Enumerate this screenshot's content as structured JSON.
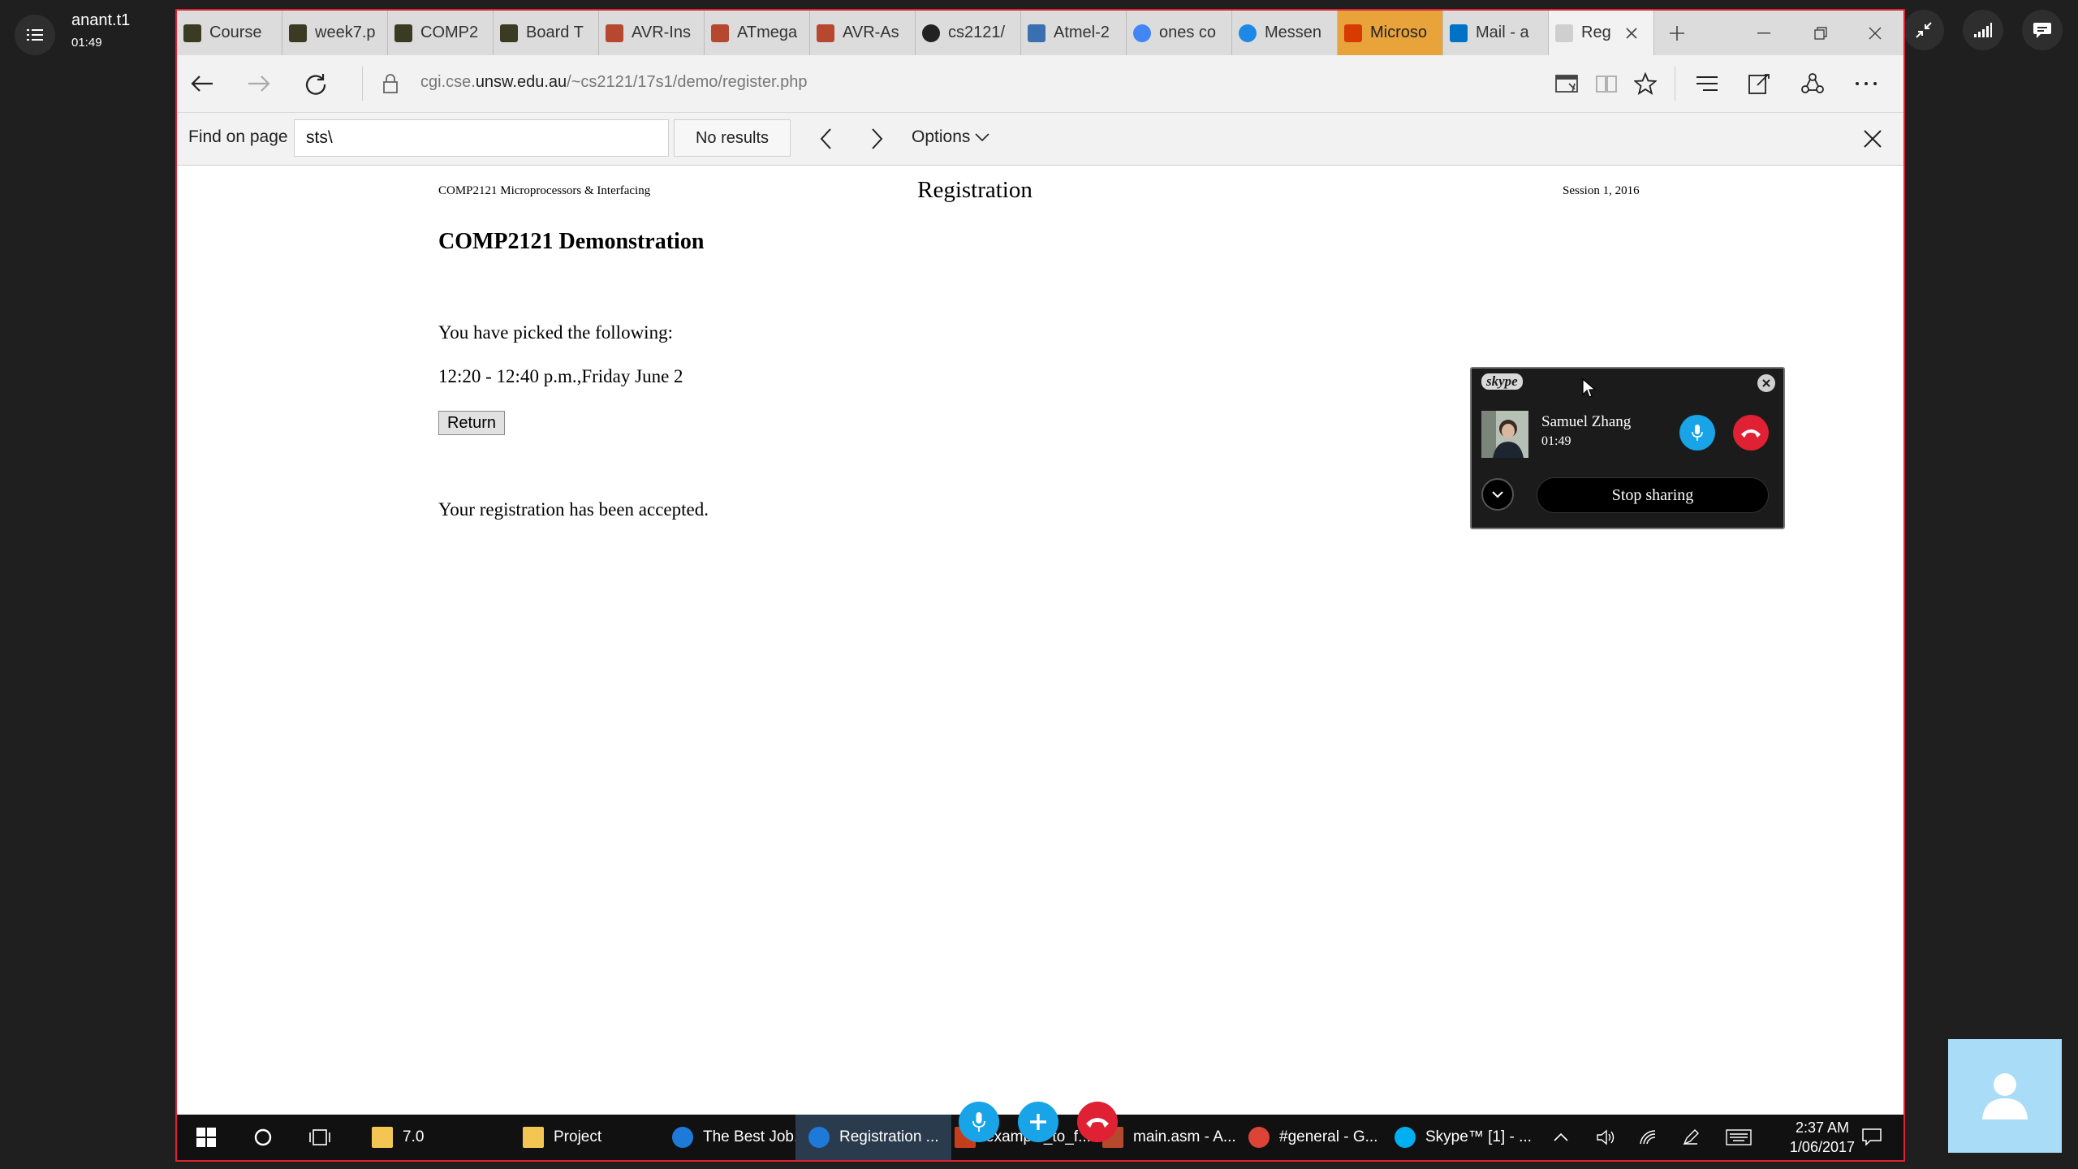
{
  "call": {
    "user_name": "anant.t1",
    "duration": "01:49",
    "menu_icon": "list-icon",
    "top_right_icons": [
      "minimize-icon",
      "signal-icon",
      "chat-icon"
    ]
  },
  "browser": {
    "tabs": [
      {
        "label": "Course"
      },
      {
        "label": "week7.p"
      },
      {
        "label": "COMP2"
      },
      {
        "label": "Board T"
      },
      {
        "label": "AVR-Ins"
      },
      {
        "label": "ATmega"
      },
      {
        "label": "AVR-As"
      },
      {
        "label": "cs2121/"
      },
      {
        "label": "Atmel-2"
      },
      {
        "label": "ones co"
      },
      {
        "label": "Messen"
      },
      {
        "label": "Microso"
      },
      {
        "label": "Mail - a"
      },
      {
        "label": "Reg"
      }
    ],
    "url_prefix": "cgi.cse.",
    "url_domain": "unsw.edu.au",
    "url_path": "/~cs2121/17s1/demo/register.php",
    "find": {
      "label": "Find on page",
      "value": "sts\\",
      "results": "No results",
      "options_label": "Options"
    }
  },
  "page": {
    "header_left": "COMP2121 Microprocessors & Interfacing",
    "header_title": "Registration",
    "header_right": "Session 1, 2016",
    "demo_title": "COMP2121 Demonstration",
    "picked_text": "You have picked the following:",
    "slot_text": "12:20 - 12:40 p.m.,Friday June 2",
    "return_label": "Return",
    "accepted_text": "Your registration has been accepted."
  },
  "skype_widget": {
    "logo": "skype",
    "contact_name": "Samuel Zhang",
    "contact_time": "01:49",
    "stop_label": "Stop sharing"
  },
  "taskbar": {
    "items": [
      {
        "label": "7.0"
      },
      {
        "label": "Project"
      },
      {
        "label": "The Best Job..."
      },
      {
        "label": "Registration ..."
      },
      {
        "label": "example_to_f..."
      },
      {
        "label": "main.asm - A..."
      },
      {
        "label": "#general - G..."
      },
      {
        "label": "Skype™ [1] - ..."
      }
    ],
    "time": "2:37 AM",
    "date": "1/06/2017"
  },
  "colors": {
    "share_border": "#e02033",
    "mic_blue": "#1aa4e8",
    "end_red": "#e02033",
    "self_view_bg": "#a9dcf6"
  }
}
